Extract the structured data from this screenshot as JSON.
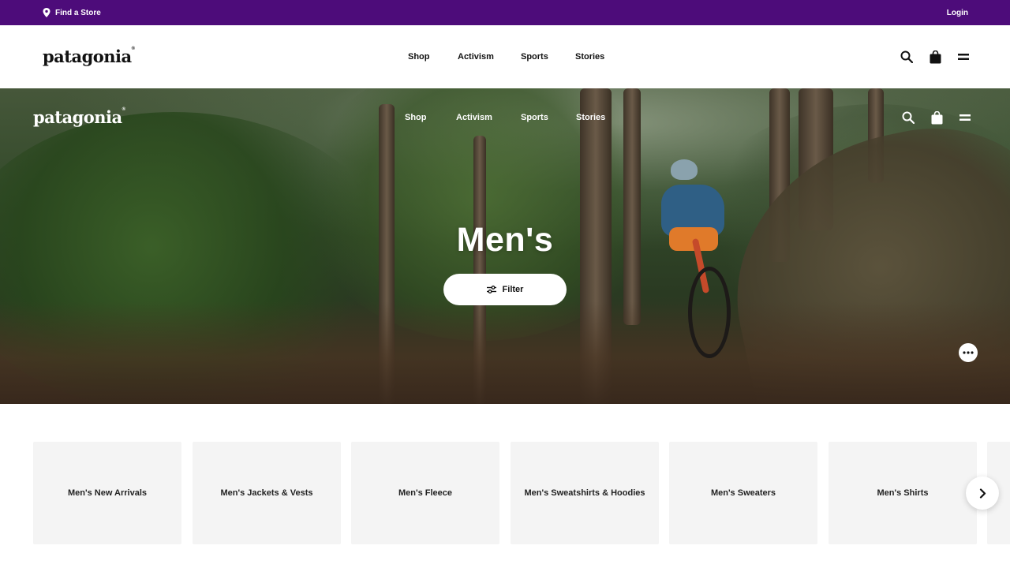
{
  "utility_bar": {
    "find_store_label": "Find a Store",
    "login_label": "Login",
    "background_color": "#4d0c7a"
  },
  "header": {
    "logo_text": "patagonia",
    "nav": [
      "Shop",
      "Activism",
      "Sports",
      "Stories"
    ],
    "icons": [
      "search-icon",
      "shopping-bag-icon",
      "menu-icon"
    ]
  },
  "hero": {
    "logo_text": "patagonia",
    "nav": [
      "Shop",
      "Activism",
      "Sports",
      "Stories"
    ],
    "title": "Men's",
    "filter_label": "Filter",
    "icons": [
      "search-icon",
      "shopping-bag-icon",
      "menu-icon",
      "more-options-icon"
    ]
  },
  "categories": [
    "Men's New Arrivals",
    "Men's Jackets & Vests",
    "Men's Fleece",
    "Men's Sweatshirts & Hoodies",
    "Men's Sweaters",
    "Men's Shirts"
  ],
  "carousel_next_icon": "chevron-right-icon"
}
